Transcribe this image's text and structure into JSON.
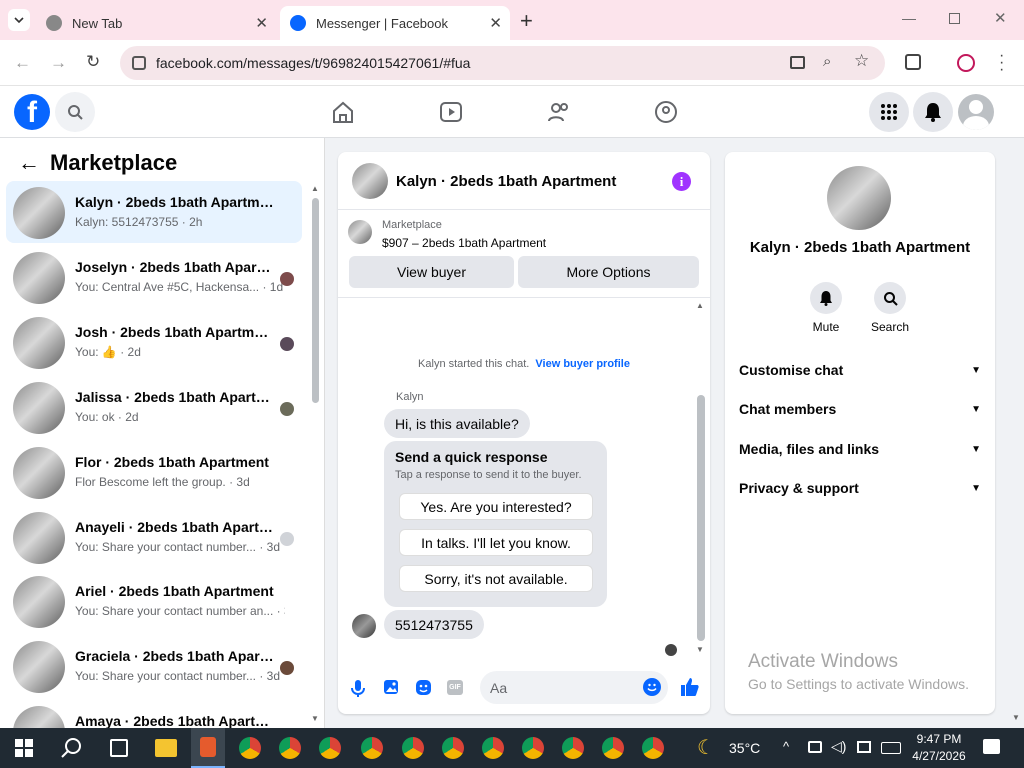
{
  "browser": {
    "tabs": [
      {
        "title": "New Tab"
      },
      {
        "title": "Messenger | Facebook"
      }
    ],
    "url": "facebook.com/messages/t/969824015427061/#fua"
  },
  "left": {
    "title": "Marketplace",
    "conversations": [
      {
        "name": "Kalyn · 2beds 1bath Apartment",
        "preview": "Kalyn: 5512473755 · 2h"
      },
      {
        "name": "Joselyn · 2beds 1bath Apartm...",
        "preview": "You: Central Ave #5C, Hackensa... · 1d"
      },
      {
        "name": "Josh · 2beds 1bath Apartment",
        "preview": "You: 👍 · 2d"
      },
      {
        "name": "Jalissa · 2beds 1bath Apartment",
        "preview": "You: ok · 2d"
      },
      {
        "name": "Flor · 2beds 1bath Apartment",
        "preview": "Flor Bescome left the group. · 3d"
      },
      {
        "name": "Anayeli · 2beds 1bath Apartm...",
        "preview": "You: Share your contact number... · 3d"
      },
      {
        "name": "Ariel · 2beds 1bath Apartment",
        "preview": "You: Share your contact number an... · 3d"
      },
      {
        "name": "Graciela · 2beds 1bath Apart...",
        "preview": "You: Share your contact number... · 3d"
      },
      {
        "name": "Amaya · 2beds 1bath Apartm...",
        "preview": ""
      }
    ]
  },
  "chat": {
    "header_name": "Kalyn · 2beds 1bath Apartment",
    "listing_source": "Marketplace",
    "listing_title": "$907 – 2beds 1bath Apartment",
    "view_buyer": "View buyer",
    "more_options": "More Options",
    "started_text": "Kalyn started this chat.",
    "view_profile": "View buyer profile",
    "sender": "Kalyn",
    "msg1": "Hi, is this available?",
    "quick_title": "Send a quick response",
    "quick_sub": "Tap a response to send it to the buyer.",
    "quick_responses": [
      "Yes. Are you interested?",
      "In talks. I'll let you know.",
      "Sorry, it's not available."
    ],
    "msg2": "5512473755",
    "composer_placeholder": "Aa"
  },
  "info": {
    "name": "Kalyn · 2beds 1bath Apartment",
    "mute": "Mute",
    "search": "Search",
    "sections": [
      "Customise chat",
      "Chat members",
      "Media, files and links",
      "Privacy & support"
    ]
  },
  "watermark": {
    "title": "Activate Windows",
    "sub": "Go to Settings to activate Windows."
  },
  "taskbar": {
    "weather": "35°C",
    "time": "9:47 PM",
    "date": "4/27/2026"
  },
  "colors": {
    "fb_blue": "#0866ff",
    "messenger_purple": "#a033ff",
    "tab_bar": "#fce4ec"
  }
}
